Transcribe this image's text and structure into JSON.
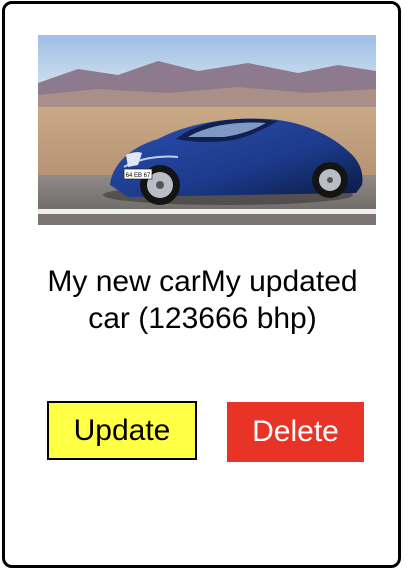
{
  "card": {
    "title": "My new carMy updated car (123666 bhp)",
    "image": {
      "subject": "blue sports car on a desert road",
      "plate_text": "64 EB 67"
    },
    "buttons": {
      "update_label": "Update",
      "delete_label": "Delete"
    }
  },
  "colors": {
    "update_button_bg": "#ffff44",
    "delete_button_bg": "#e83426",
    "car_body": "#1c3a8a",
    "card_border": "#000000"
  }
}
